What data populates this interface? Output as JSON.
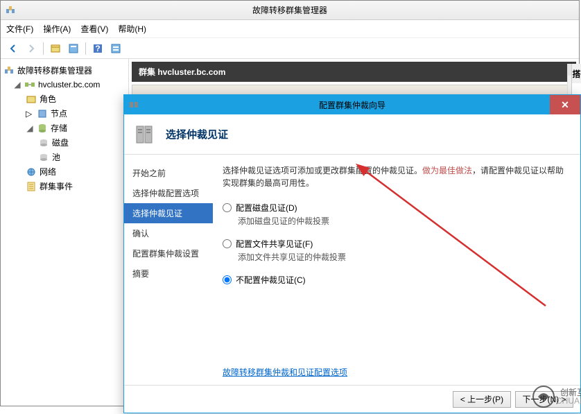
{
  "window": {
    "title": "故障转移群集管理器"
  },
  "menu": {
    "file": "文件(F)",
    "action": "操作(A)",
    "view": "查看(V)",
    "help": "帮助(H)"
  },
  "tree": {
    "root": "故障转移群集管理器",
    "cluster": "hvcluster.bc.com",
    "roles": "角色",
    "nodes": "节点",
    "storage": "存储",
    "disks": "磁盘",
    "pools": "池",
    "networks": "网络",
    "events": "群集事件"
  },
  "content": {
    "header": "群集 hvcluster.bc.com"
  },
  "rightpane": {
    "header": "搭"
  },
  "wizard": {
    "title": "配置群集仲裁向导",
    "header": "选择仲裁见证",
    "nav": {
      "start": "开始之前",
      "select_quorum": "选择仲裁配置选项",
      "select_witness": "选择仲裁见证",
      "confirm": "确认",
      "config": "配置群集仲裁设置",
      "summary": "摘要"
    },
    "desc": {
      "plain1": "选择仲裁见证选项可添加或更改群集配置的仲裁见证。",
      "highlight": "做为最佳做法",
      "plain2": "，请配置仲裁见证以帮助实现群集的最高可用性。"
    },
    "opts": {
      "disk_label": "配置磁盘见证(D)",
      "disk_sub": "添加磁盘见证的仲裁投票",
      "share_label": "配置文件共享见证(F)",
      "share_sub": "添加文件共享见证的仲裁投票",
      "none_label": "不配置仲裁见证(C)"
    },
    "link": "故障转移群集仲裁和见证配置选项",
    "buttons": {
      "back": "< 上一步(P)",
      "next": "下一步(N) >"
    }
  },
  "watermark": {
    "text": "创新互联"
  }
}
